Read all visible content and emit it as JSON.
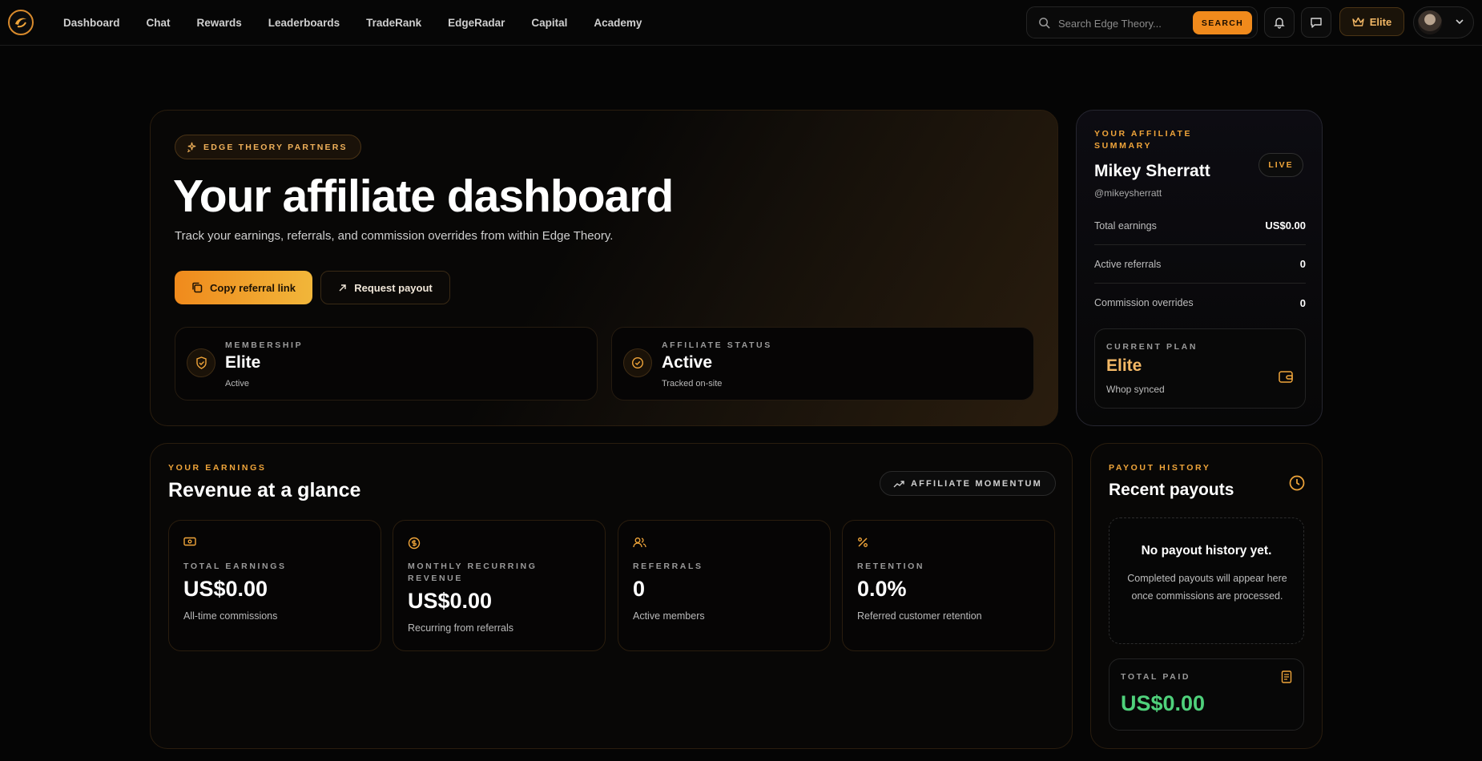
{
  "nav": {
    "items": [
      "Dashboard",
      "Chat",
      "Rewards",
      "Leaderboards",
      "TradeRank",
      "EdgeRadar",
      "Capital",
      "Academy"
    ],
    "search_placeholder": "Search Edge Theory...",
    "search_button": "SEARCH",
    "plan_badge": "Elite"
  },
  "hero": {
    "pill": "EDGE THEORY PARTNERS",
    "title": "Your affiliate dashboard",
    "subtitle": "Track your earnings, referrals, and commission overrides from within Edge Theory.",
    "copy_button": "Copy referral link",
    "payout_button": "Request payout",
    "membership": {
      "label": "MEMBERSHIP",
      "value": "Elite",
      "sub": "Active"
    },
    "affiliate_status": {
      "label": "AFFILIATE STATUS",
      "value": "Active",
      "sub": "Tracked on-site"
    }
  },
  "summary": {
    "eyebrow": "YOUR AFFILIATE SUMMARY",
    "live": "LIVE",
    "name": "Mikey Sherratt",
    "handle": "@mikeysherratt",
    "rows": [
      {
        "label": "Total earnings",
        "value": "US$0.00"
      },
      {
        "label": "Active referrals",
        "value": "0"
      },
      {
        "label": "Commission overrides",
        "value": "0"
      }
    ],
    "plan": {
      "label": "CURRENT PLAN",
      "value": "Elite",
      "sub": "Whop synced"
    }
  },
  "earnings": {
    "eyebrow": "YOUR EARNINGS",
    "title": "Revenue at a glance",
    "momentum": "AFFILIATE MOMENTUM",
    "metrics": [
      {
        "label": "TOTAL EARNINGS",
        "value": "US$0.00",
        "desc": "All-time commissions"
      },
      {
        "label": "MONTHLY RECURRING REVENUE",
        "value": "US$0.00",
        "desc": "Recurring from referrals"
      },
      {
        "label": "REFERRALS",
        "value": "0",
        "desc": "Active members"
      },
      {
        "label": "RETENTION",
        "value": "0.0%",
        "desc": "Referred customer retention"
      }
    ]
  },
  "payouts": {
    "eyebrow": "PAYOUT HISTORY",
    "title": "Recent payouts",
    "empty_title": "No payout history yet.",
    "empty_desc": "Completed payouts will appear here once commissions are processed.",
    "total_label": "TOTAL PAID",
    "total_value": "US$0.00"
  },
  "colors": {
    "accent": "#f08a1c",
    "gold": "#f3b866",
    "success": "#4fd17b"
  }
}
